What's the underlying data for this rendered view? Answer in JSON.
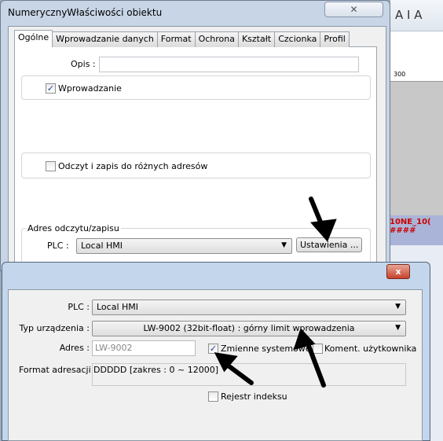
{
  "background_app": {
    "toolbar_glyphs": "A  I  A",
    "ruler_mark": "300",
    "tag_text": "10NE_10(\n####"
  },
  "dialog1": {
    "title": "NumerycznyWłaściwości obiektu",
    "close": "✕",
    "tabs": [
      "Ogólne",
      "Wprowadzanie danych",
      "Format",
      "Ochrona",
      "Kształt",
      "Czcionka",
      "Profil"
    ],
    "opis_label": "Opis :",
    "opis_value": "",
    "wprowadzanie": {
      "label": "Wprowadzanie",
      "checked": true
    },
    "odczyt_zapis": {
      "label": "Odczyt i zapis do różnych adresów",
      "checked": false
    },
    "group_label": "Adres odczytu/zapisu",
    "plc_label": "PLC :",
    "plc_value": "Local HMI",
    "settings_button": "Ustawienia ..."
  },
  "dialog2": {
    "close": "x",
    "plc_label": "PLC :",
    "plc_value": "Local HMI",
    "device_label": "Typ urządzenia :",
    "device_value": "LW-9002 (32bit-float) : górny limit wprowadzenia",
    "address_label": "Adres :",
    "address_value": "LW-9002",
    "system_vars": {
      "label": "Zmienne systemowe",
      "checked": true
    },
    "user_comment": {
      "label": "Koment. użytkownika",
      "checked": false
    },
    "format_label": "Format adresacji :",
    "format_value": "DDDDD [zakres : 0 ~ 12000]",
    "index_reg": {
      "label": "Rejestr indeksu",
      "checked": false
    }
  }
}
